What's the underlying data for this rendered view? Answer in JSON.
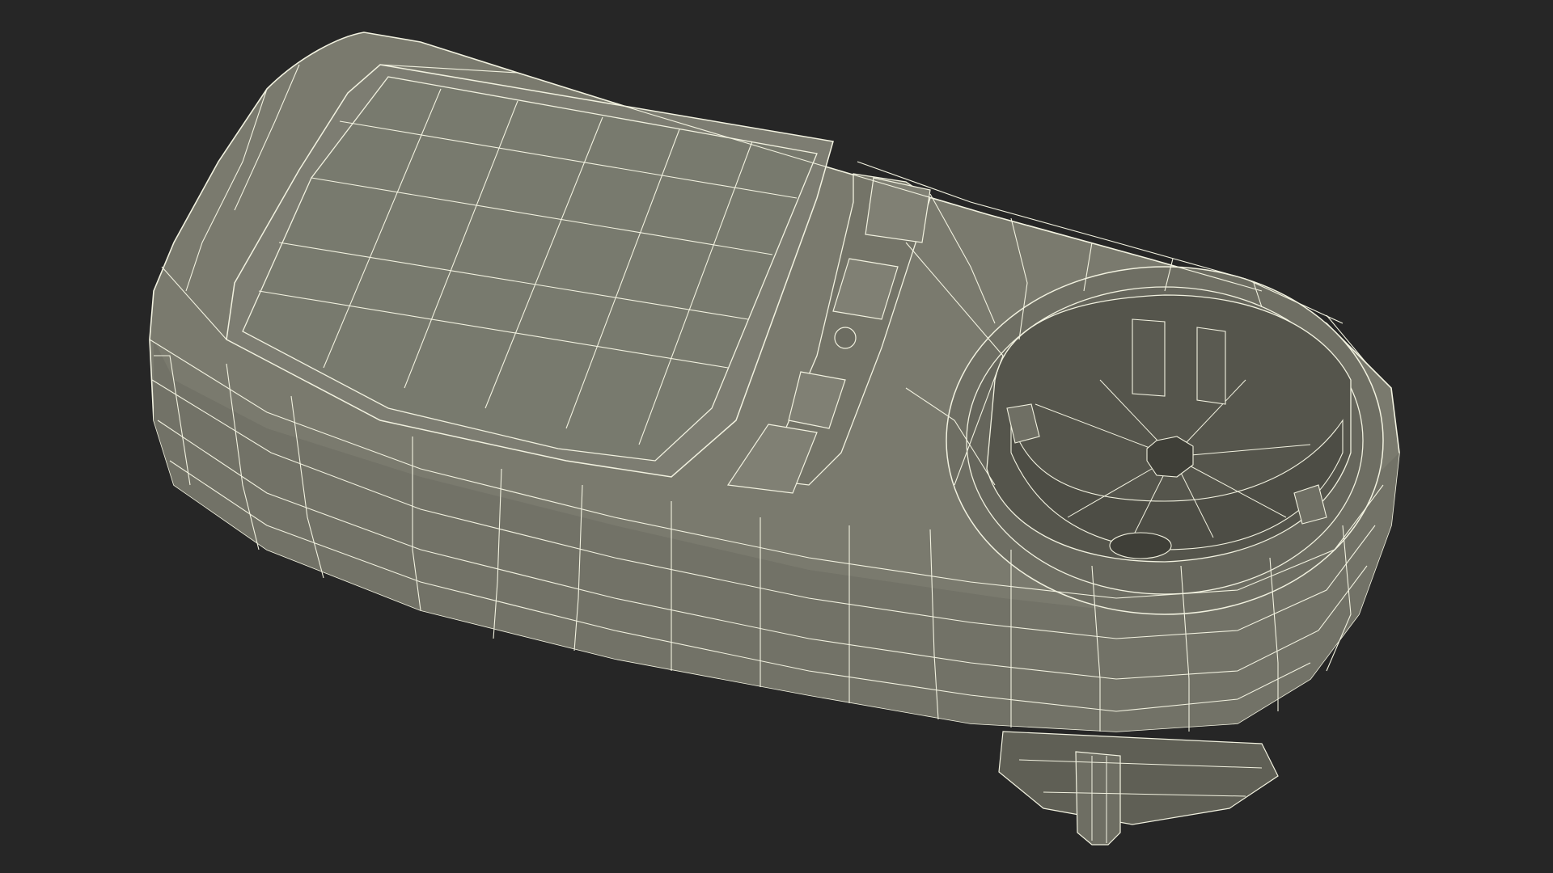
{
  "scene": {
    "subject": "wireframe-power-meter-plug-adapter",
    "render_style": "gray-shaded-wireframe",
    "colors": {
      "background": "#262626",
      "surface": "#7a7a6e",
      "surface_dark": "#5f5f55",
      "surface_shadow": "#45453e",
      "socket_inner": "#55554c",
      "wire": "#f2f2e0"
    }
  }
}
